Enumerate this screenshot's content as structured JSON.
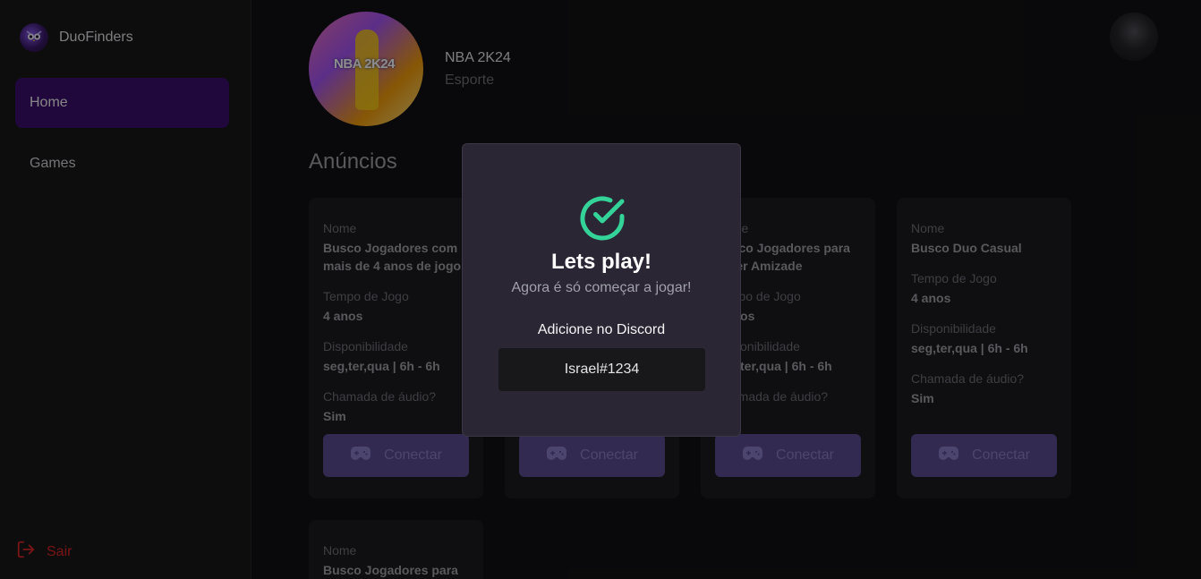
{
  "brand": {
    "name": "DuoFinders",
    "logo_icon": "owl-logo-icon"
  },
  "sidebar": {
    "items": [
      {
        "label": "Home",
        "active": true
      },
      {
        "label": "Games",
        "active": false
      }
    ],
    "logout_label": "Sair"
  },
  "game": {
    "title": "NBA 2K24",
    "genre": "Esporte",
    "cover_text": "NBA 2K24"
  },
  "section_title": "Anúncios",
  "ad_fields": {
    "name_label": "Nome",
    "time_label": "Tempo de Jogo",
    "availability_label": "Disponibilidade",
    "audio_label": "Chamada de áudio?"
  },
  "ads": [
    {
      "name": "Busco Jogadores com mais de 4 anos de jogo",
      "time": "4 anos",
      "availability": "seg,ter,qua | 6h - 6h",
      "audio": "Sim",
      "button": "Conectar"
    },
    {
      "name": "",
      "time": "",
      "availability": "",
      "audio": "",
      "button": "Conectar"
    },
    {
      "name": "Busco Jogadores para Fazer Amizade",
      "time": "4 anos",
      "availability": "seg,ter,qua | 6h - 6h",
      "audio": "",
      "button": "Conectar"
    },
    {
      "name": "Busco Duo Casual",
      "time": "4 anos",
      "availability": "seg,ter,qua | 6h - 6h",
      "audio": "Sim",
      "button": "Conectar"
    },
    {
      "name": "Busco Jogadores para",
      "time": "",
      "availability": "",
      "audio": "",
      "button": ""
    }
  ],
  "modal": {
    "title": "Lets play!",
    "subtitle": "Agora é só começar a jogar!",
    "discord_label": "Adicione no Discord",
    "discord_value": "Israel#1234",
    "accent_color": "#34d399"
  },
  "colors": {
    "sidebar_active": "#3b0d6e",
    "button": "#5b4e92",
    "logout": "#dc2626"
  }
}
